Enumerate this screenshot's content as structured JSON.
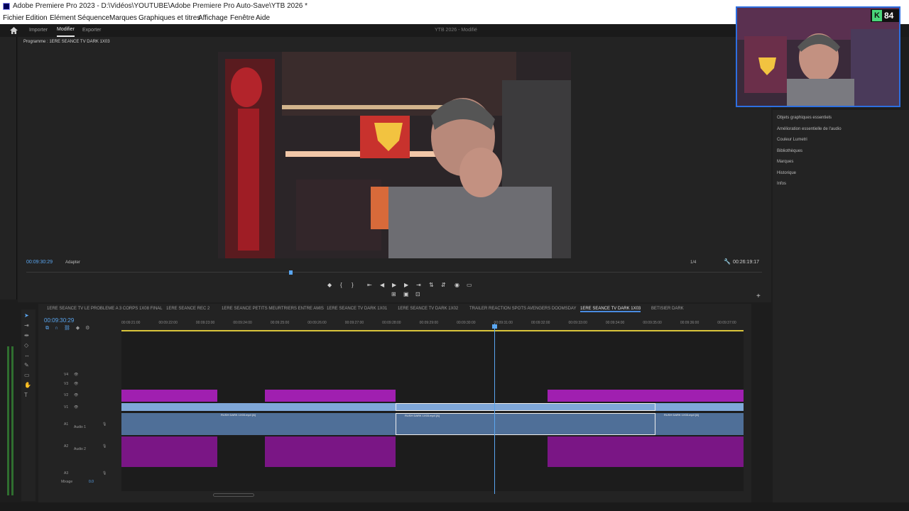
{
  "window": {
    "title": "Adobe Premiere Pro 2023 - D:\\Vidéos\\YOUTUBE\\Adobe Premiere Pro Auto-Save\\YTB 2026 *"
  },
  "menu": [
    "Fichier",
    "Edition",
    "Elément",
    "Séquence",
    "Marques",
    "Graphiques et titres",
    "Affichage",
    "Fenêtre",
    "Aide"
  ],
  "workspace": {
    "tabs": [
      "Importer",
      "Modifier",
      "Exporter"
    ],
    "project": "YTB 2026 - Modifié"
  },
  "program": {
    "header": "Programme : 1ERE SEANCE TV DARK 1X03",
    "timecode": "00:09:30:29",
    "fit": "Adapter",
    "zoom": "1/4",
    "duration": "00:26:19:17"
  },
  "right_panel": [
    "Objets graphiques essentiels",
    "Amélioration essentielle de l'audio",
    "Couleur Lumetri",
    "Bibliothèques",
    "Marques",
    "Historique",
    "Infos"
  ],
  "badge": {
    "letter": "K",
    "count": "84"
  },
  "timeline": {
    "tabs": [
      "1ERE SEANCE TV LE PROBLEME A 3 CORPS 1X08 FINAL",
      "1ERE SEANCE REC 2",
      "1ERE SEANCE PETITS MEURTRIERS ENTRE AMIS",
      "1ERE SEANCE TV DARK 1X01",
      "1ERE SEANCE TV DARK 1X02",
      "TRAILER REACTION SPOTS AVENGERS DOOMSDAY",
      "1ERE SEANCE TV DARK 1X03",
      "BETISIER DARK"
    ],
    "active_tab": "1ERE SEANCE TV DARK 1X03",
    "timecode": "00:09:30:29",
    "ruler": [
      "00:09:21:00",
      "00:09:22:00",
      "00:09:23:00",
      "00:09:24:00",
      "00:09:25:00",
      "00:09:26:00",
      "00:09:27:00",
      "00:09:28:00",
      "00:09:29:00",
      "00:09:30:00",
      "00:09:31:00",
      "00:09:32:00",
      "00:09:33:00",
      "00:09:34:00",
      "00:09:35:00",
      "00:09:36:00",
      "00:09:37:00"
    ],
    "tracks": {
      "v4": "V4",
      "v3": "V3",
      "v2": "V2",
      "v1": "V1",
      "a1": "A1",
      "a1name": "Audio 1",
      "a2": "A2",
      "a2name": "Audio 2",
      "a3": "A3",
      "mix": "Mixage",
      "mixval": "0.0"
    },
    "clip_label": "RUSH DARK 1X03.mp4 [A]"
  }
}
